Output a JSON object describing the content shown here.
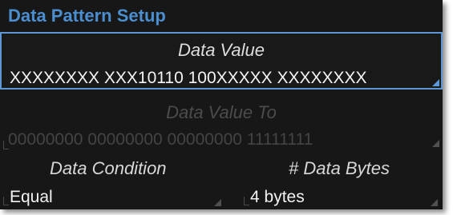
{
  "dialog": {
    "title": "Data Pattern Setup"
  },
  "data_value": {
    "label": "Data Value",
    "value": "XXXXXXXX XXX10110 100XXXXX XXXXXXXX"
  },
  "data_value_to": {
    "label": "Data Value To",
    "value": "00000000 00000000 00000000 11111111"
  },
  "data_condition": {
    "label": "Data Condition",
    "selected": "Equal"
  },
  "data_bytes": {
    "label": "# Data Bytes",
    "selected": "4 bytes"
  },
  "colors": {
    "title_blue": "#4a8ed0",
    "focus_border": "#5e97d6",
    "panel_bg": "#171717"
  }
}
